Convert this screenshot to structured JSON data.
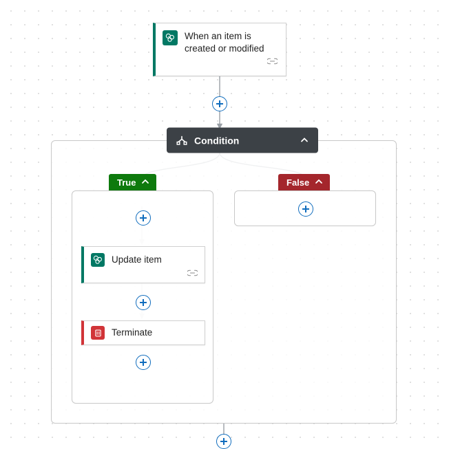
{
  "trigger": {
    "title": "When an item is created or modified",
    "connector": "SharePoint",
    "accent": "#017864"
  },
  "condition": {
    "label": "Condition",
    "true": {
      "label": "True",
      "actions": [
        {
          "id": "update",
          "label": "Update item",
          "connector": "SharePoint",
          "accent": "#017864"
        },
        {
          "id": "terminate",
          "label": "Terminate",
          "connector": "Control",
          "accent": "#d13438"
        }
      ]
    },
    "false": {
      "label": "False"
    }
  }
}
